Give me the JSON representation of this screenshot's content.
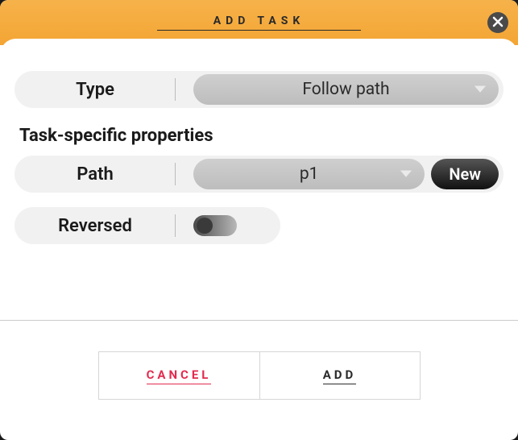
{
  "dialog": {
    "title": "ADD TASK"
  },
  "fields": {
    "type": {
      "label": "Type",
      "value": "Follow path"
    }
  },
  "section_title": "Task-specific properties",
  "task_props": {
    "path": {
      "label": "Path",
      "value": "p1",
      "new_button": "New"
    },
    "reversed": {
      "label": "Reversed",
      "value": false
    }
  },
  "footer": {
    "cancel": "CANCEL",
    "add": "ADD"
  }
}
